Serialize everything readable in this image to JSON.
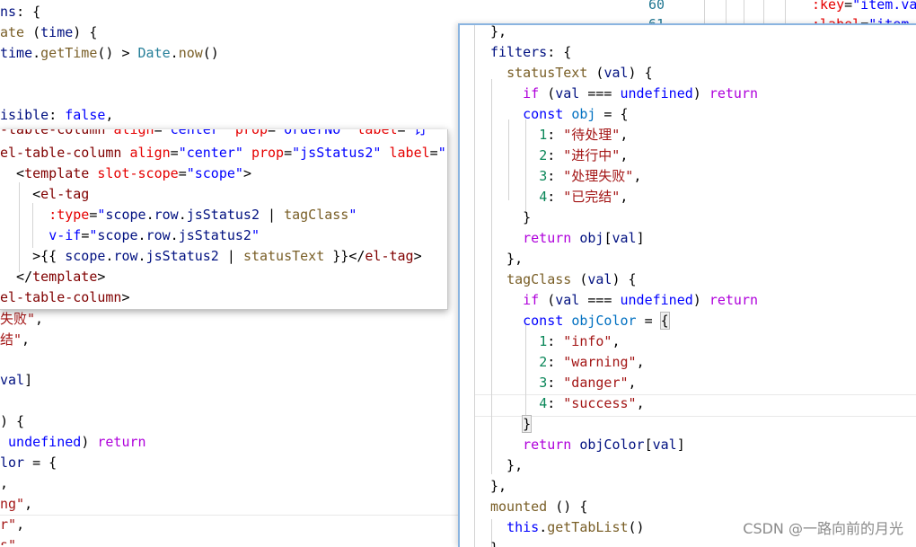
{
  "background_code": {
    "lines": [
      "ns: {",
      "ate (time) {",
      "time.getTime() > Date.now()",
      "",
      "",
      "isible: false,",
      "",
      "",
      "",
      "",
      "",
      "",
      "",
      "",
      "",
      "失败\",",
      "结\",",
      "",
      "val]",
      "",
      ") {",
      " undefined) return",
      "lor = {",
      ",",
      "ng\",",
      "r\",",
      "s\""
    ]
  },
  "template_popup": {
    "lines": [
      "el-table-column align=\"center\" prop=\"jsStatus2\" label=\"",
      "  <template slot-scope=\"scope\">",
      "    <el-tag",
      "      :type=\"scope.row.jsStatus2 | tagClass\"",
      "      v-if=\"scope.row.jsStatus2\"",
      "    >{{ scope.row.jsStatus2 | statusText }}</el-tag>",
      "  </template>",
      "el-table-column>"
    ],
    "clipped_top": "-table-column align=\"center\" prop=\"orderNo\" label=\"订"
  },
  "filters_popup": {
    "lines": [
      "},",
      "filters: {",
      "  statusText (val) {",
      "    if (val === undefined) return",
      "    const obj = {",
      "      1: \"待处理\",",
      "      2: \"进行中\",",
      "      3: \"处理失败\",",
      "      4: \"已完结\",",
      "    }",
      "    return obj[val]",
      "  },",
      "  tagClass (val) {",
      "    if (val === undefined) return",
      "    const objColor = {",
      "      1: \"info\",",
      "      2: \"warning\",",
      "      3: \"danger\",",
      "      4: \"success\",",
      "    }",
      "    return objColor[val]",
      "  },",
      "},",
      "mounted () {",
      "  this.getTabList()",
      "}"
    ]
  },
  "top_right": {
    "line_number": "60",
    "line_number_next": "61",
    "code": ":key=\"item.va",
    "code_next": ":label=\"item"
  },
  "watermark": "CSDN @一路向前的月光",
  "colors": {
    "keyword": "#af00db",
    "storage": "#0000ff",
    "identifier": "#001080",
    "function": "#795e26",
    "string": "#a31515",
    "number": "#098658",
    "tag": "#800000",
    "attribute": "#e50000"
  }
}
